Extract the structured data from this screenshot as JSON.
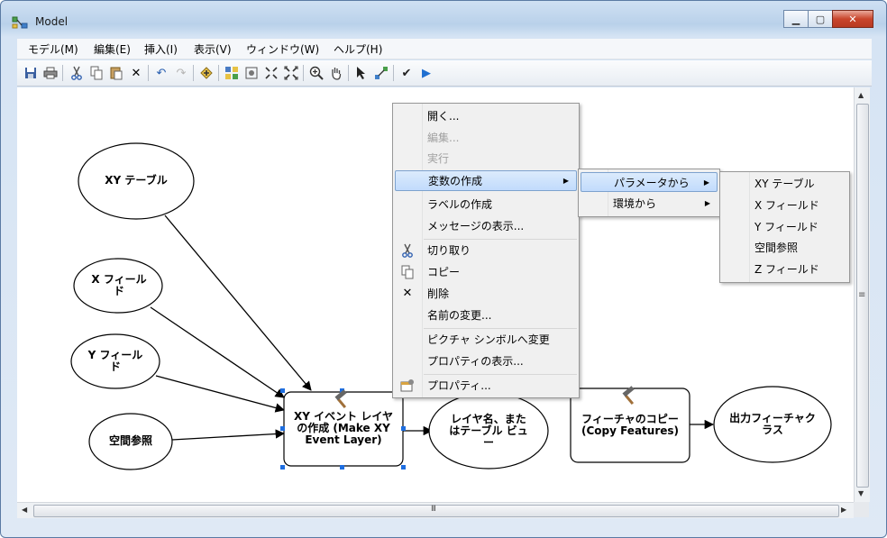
{
  "window": {
    "title": "Model"
  },
  "window_buttons": {
    "minimize": "▁",
    "maximize": "▢",
    "close": "✕"
  },
  "menubar": [
    "モデル(M)",
    "編集(E)",
    "挿入(I)",
    "表示(V)",
    "ウィンドウ(W)",
    "ヘルプ(H)"
  ],
  "toolbar_icons": [
    "save-icon",
    "print-icon",
    "cut-icon",
    "copy-icon",
    "paste-icon",
    "delete-icon",
    "undo-icon",
    "redo-icon",
    "add-data-icon",
    "auto-layout-icon",
    "full-extent-icon",
    "zoom-in-fixed-icon",
    "zoom-out-fixed-icon",
    "zoom-in-icon",
    "pan-icon",
    "select-icon",
    "connect-icon",
    "validate-icon",
    "run-icon"
  ],
  "nodes": {
    "xy_table": "XY テーブル",
    "x_field": "X フィール\nド",
    "y_field": "Y フィール\nド",
    "spatial_ref": "空間参照",
    "make_xy": "XY イベント レイヤ\nの作成 (Make XY\nEvent Layer)",
    "layer_name": "レイヤ名、また\nはテーブル ビュ\nー",
    "copy_features": "フィーチャのコピー\n(Copy Features)",
    "output_fc": "出力フィーチャク\nラス"
  },
  "context_menu": {
    "items": [
      {
        "label": "開く...",
        "enabled": true
      },
      {
        "label": "編集...",
        "enabled": false
      },
      {
        "label": "実行",
        "enabled": false
      },
      {
        "label": "変数の作成",
        "enabled": true,
        "submenu": true,
        "highlighted": true
      },
      {
        "label": "ラベルの作成",
        "enabled": true
      },
      {
        "label": "メッセージの表示...",
        "enabled": true
      },
      {
        "label": "切り取り",
        "enabled": true,
        "icon": "cut-icon"
      },
      {
        "label": "コピー",
        "enabled": true,
        "icon": "copy-icon"
      },
      {
        "label": "削除",
        "enabled": true,
        "icon": "delete-icon"
      },
      {
        "label": "名前の変更...",
        "enabled": true
      },
      {
        "label": "ピクチャ シンボルへ変更",
        "enabled": true
      },
      {
        "label": "プロパティの表示...",
        "enabled": true
      },
      {
        "label": "プロパティ...",
        "enabled": true,
        "icon": "properties-icon"
      }
    ]
  },
  "submenu1": {
    "items": [
      {
        "label": "パラメータから",
        "highlighted": true
      },
      {
        "label": "環境から"
      }
    ]
  },
  "submenu2": {
    "items": [
      "XY テーブル",
      "X フィールド",
      "Y フィールド",
      "空間参照",
      "Z フィールド"
    ]
  },
  "scroll": {
    "grip": "≡",
    "hgrip": "III"
  }
}
